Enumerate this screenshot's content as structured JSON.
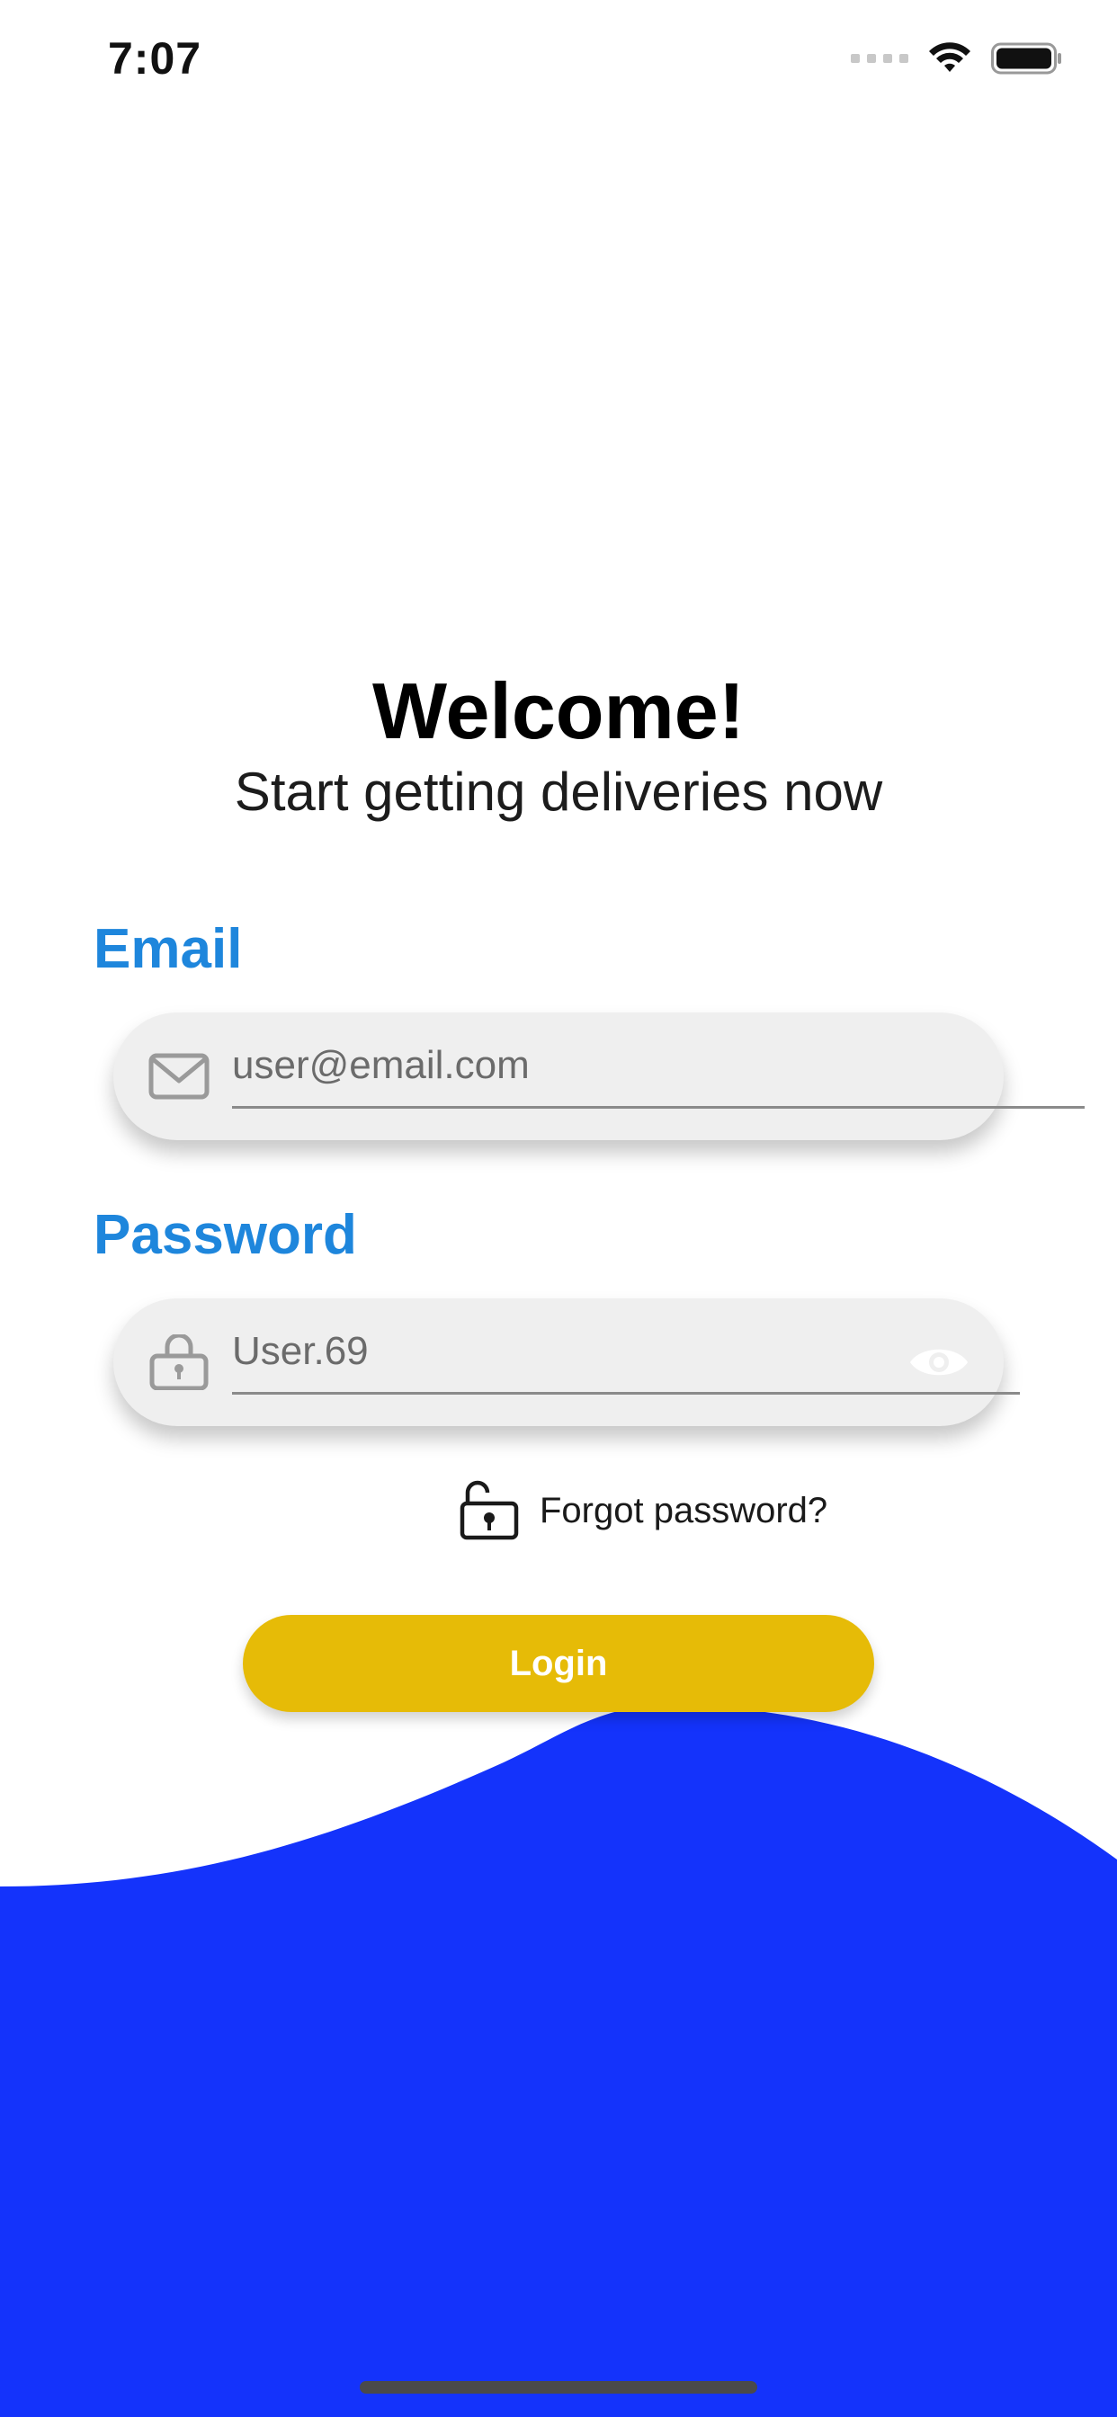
{
  "status_bar": {
    "time": "7:07"
  },
  "welcome": {
    "title": "Welcome!",
    "subtitle": "Start getting deliveries now"
  },
  "email": {
    "label": "Email",
    "value": "user@email.com",
    "icon": "envelope-icon"
  },
  "password": {
    "label": "Password",
    "value": "User.69",
    "icon": "lock-icon",
    "toggle_icon": "eye-icon"
  },
  "forgot": {
    "label": "Forgot password?",
    "icon": "unlock-icon"
  },
  "login": {
    "label": "Login"
  },
  "colors": {
    "accent_label": "#1e86dc",
    "login_button": "#e6bb07",
    "wave": "#1433fb",
    "field_bg": "#efefef"
  }
}
